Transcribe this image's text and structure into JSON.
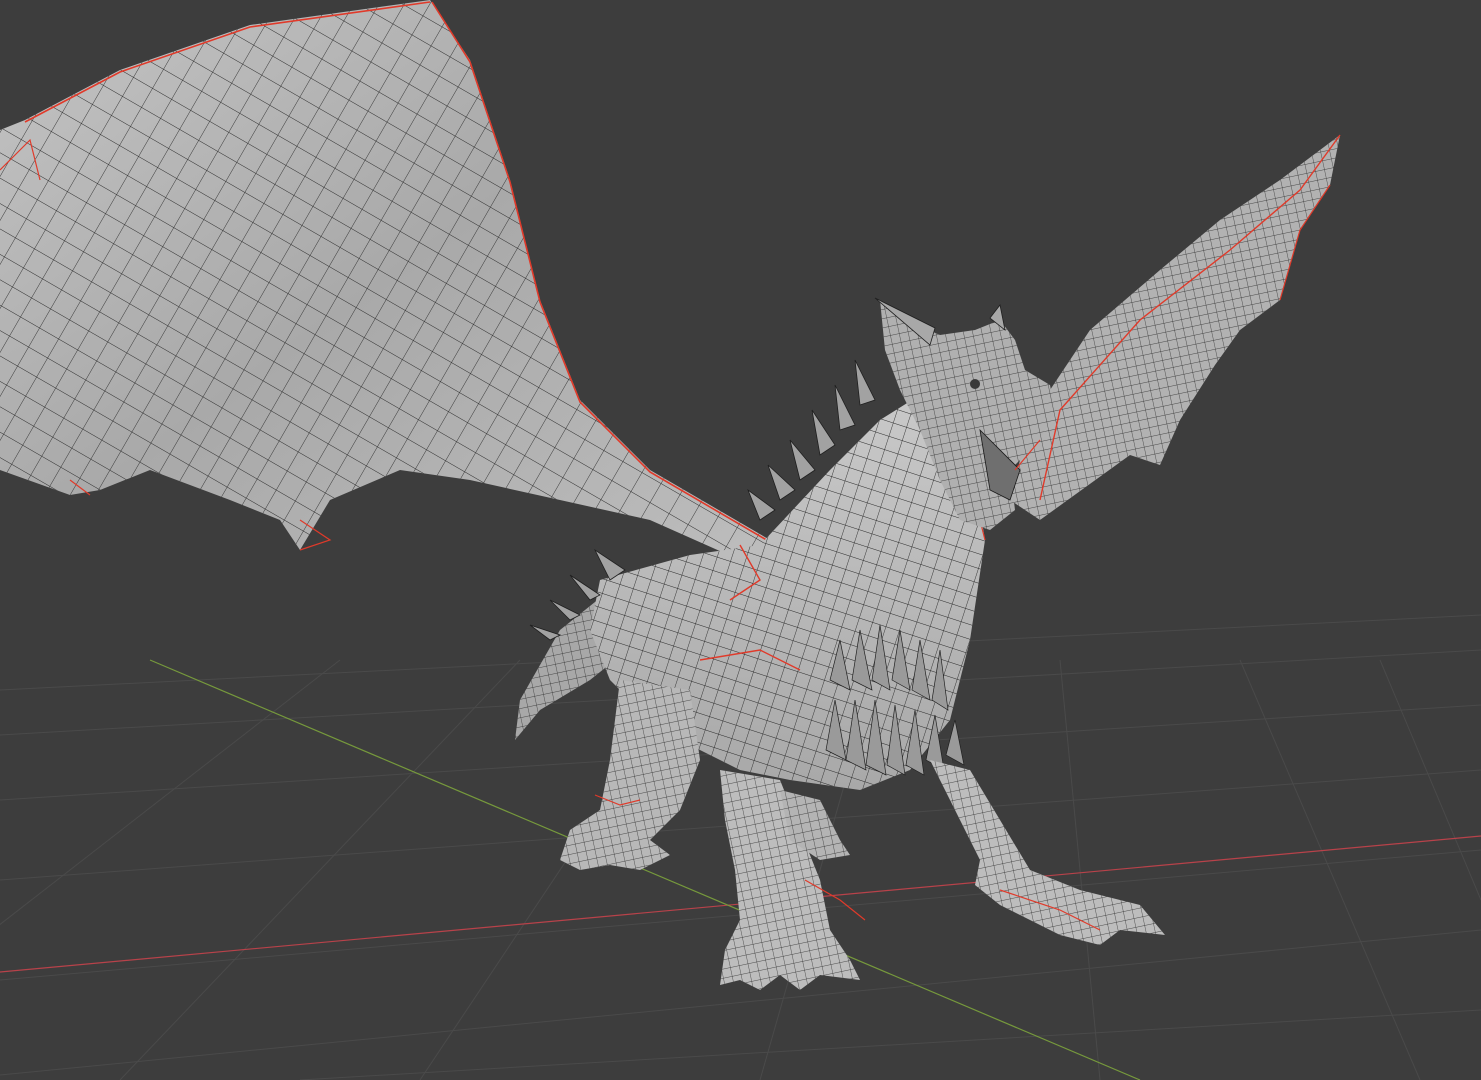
{
  "viewport": {
    "background": "#3d3d3d",
    "grid_color": "#4a4a4a",
    "x_axis_color": "#c2474f",
    "y_axis_color": "#7fa641"
  },
  "model": {
    "object": "dragon-mesh",
    "display": "wireframe-overlay",
    "surface_color": "#b9b9b9",
    "wire_color": "#1f1f1f",
    "seam_color": "#e03a2a"
  }
}
